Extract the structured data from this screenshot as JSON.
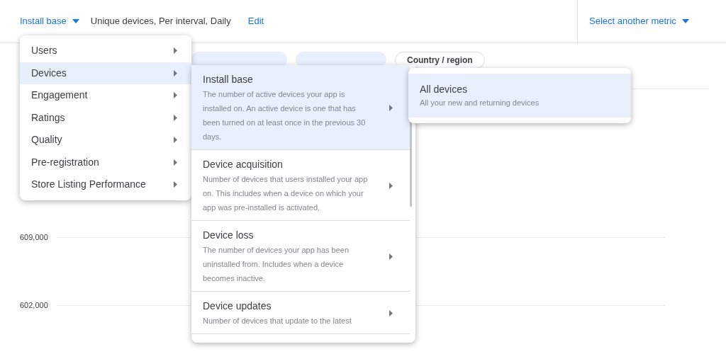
{
  "header": {
    "metric": "Install base",
    "details": "Unique devices, Per interval, Daily",
    "edit": "Edit",
    "select_metric": "Select another metric"
  },
  "filter_chips": [
    {
      "kind": "filled"
    },
    {
      "kind": "filled"
    },
    {
      "kind": "outlined",
      "label": "Country / region"
    }
  ],
  "y_axis_labels": [
    "609,000",
    "602,000"
  ],
  "category_menu": [
    {
      "label": "Users",
      "selected": false
    },
    {
      "label": "Devices",
      "selected": true
    },
    {
      "label": "Engagement",
      "selected": false
    },
    {
      "label": "Ratings",
      "selected": false
    },
    {
      "label": "Quality",
      "selected": false
    },
    {
      "label": "Pre-registration",
      "selected": false
    },
    {
      "label": "Store Listing Performance",
      "selected": false
    }
  ],
  "metric_menu": [
    {
      "title": "Install base",
      "description": "The number of active devices your app is installed on. An active device is one that has been turned on at least once in the previous 30 days.",
      "selected": true
    },
    {
      "title": "Device acquisition",
      "description": "Number of devices that users installed your app on. This includes when a device on which your app was pre-installed is activated.",
      "selected": false
    },
    {
      "title": "Device loss",
      "description": "The number of devices your app has been uninstalled from. Includes when a device becomes inactive.",
      "selected": false
    },
    {
      "title": "Device updates",
      "description": "Number of devices that update to the latest",
      "selected": false
    }
  ],
  "submenu": [
    {
      "title": "All devices",
      "description": "All your new and returning devices",
      "selected": true
    }
  ]
}
